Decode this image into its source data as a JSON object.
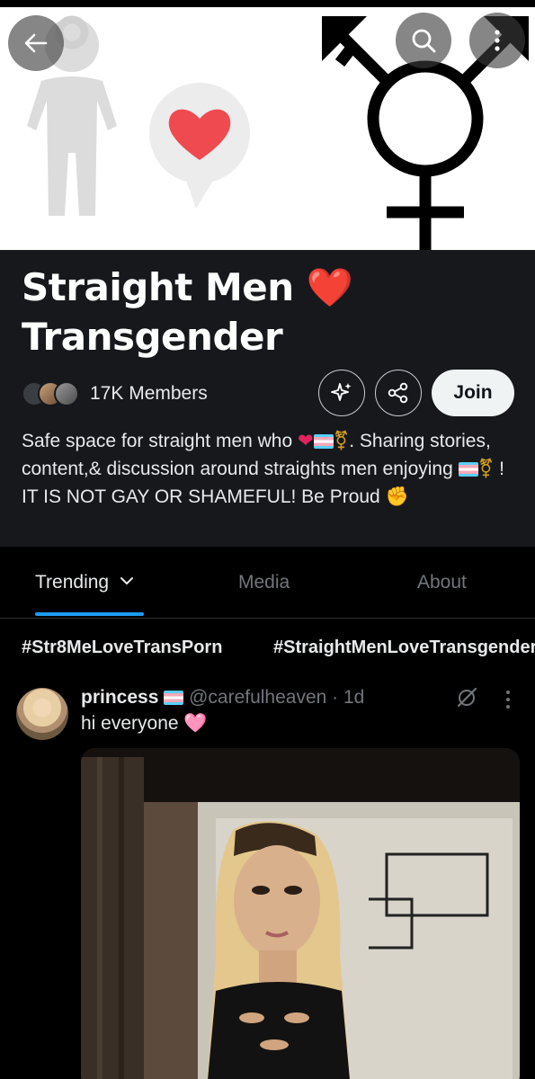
{
  "app": {
    "accent": "#1d9bf0",
    "background": "#000000"
  },
  "banner": {
    "back_icon": "arrow-left-icon",
    "search_icon": "search-icon",
    "more_icon": "more-vertical-icon"
  },
  "community": {
    "title_line1": "Straight Men",
    "title_heart": "❤️",
    "title_line2": "Transgender",
    "members_label": "17K Members",
    "sparkle_icon": "sparkle-icon",
    "share_icon": "share-icon",
    "join_label": "Join",
    "description": {
      "part1": "Safe space for straight men who ",
      "part2": ". Sharing stories, content,& discussion around straights men enjoying ",
      "part3": " ! IT IS NOT GAY OR SHAMEFUL! Be Proud "
    }
  },
  "tabs": [
    {
      "label": "Trending"
    },
    {
      "label": "Media"
    },
    {
      "label": "About"
    }
  ],
  "hashtags": [
    "#Str8MeLoveTransPorn",
    "#StraightMenLoveTransgender"
  ],
  "post": {
    "name": "princess",
    "handle": "@carefulheaven",
    "time": "· 1d",
    "text": "hi everyone ",
    "text_emoji": "🩷"
  }
}
